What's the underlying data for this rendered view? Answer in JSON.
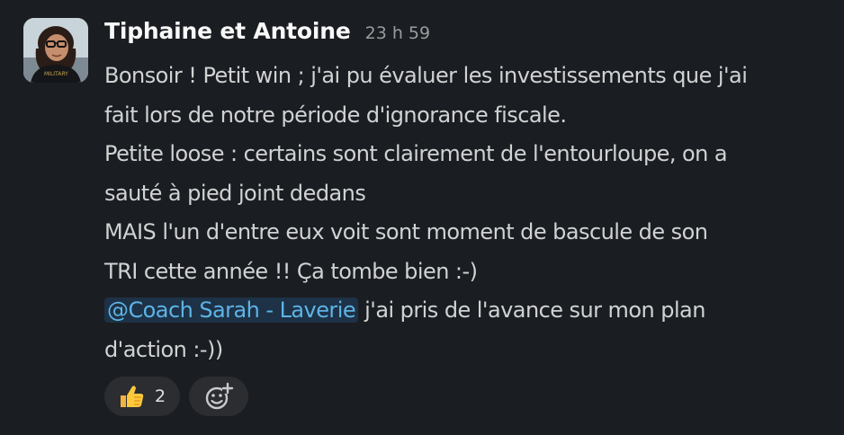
{
  "message": {
    "author": "Tiphaine et Antoine",
    "timestamp": "23 h 59",
    "lines": [
      "Bonsoir ! Petit win ; j'ai pu évaluer les investissements que j'ai",
      "fait lors de notre période d'ignorance fiscale.",
      "Petite loose : certains sont clairement de l'entourloupe, on a",
      "sauté à pied joint dedans",
      "MAIS l'un d'entre eux voit sont moment de bascule de son",
      "TRI cette année !! Ça tombe bien :-)"
    ],
    "mention": "@Coach Sarah - Laverie",
    "mention_suffix": " j'ai pris de l'avance sur mon plan",
    "last_line": "d'action :-))",
    "avatar_shirt_text": "MILITARY"
  },
  "reactions": [
    {
      "emoji": "thumbs-up-icon",
      "count": "2"
    }
  ],
  "add_reaction": {
    "icon": "add-reaction-icon"
  },
  "colors": {
    "background": "#1a1d21",
    "text": "#d1d2d3",
    "author": "#f8f8f8",
    "timestamp": "#9a9b9d",
    "mention_bg": "#1d3246",
    "mention_text": "#5eb3e6",
    "reaction_bg": "#2b2d31"
  }
}
